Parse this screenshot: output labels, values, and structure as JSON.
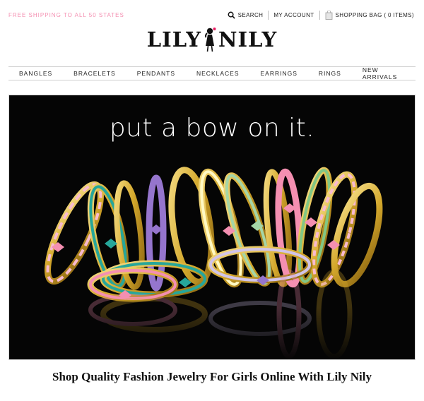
{
  "promo": {
    "text": "FREE SHIPPING TO ALL 50 STATES",
    "color": "#f48fb1"
  },
  "utility": {
    "search_label": "SEARCH",
    "account_label": "MY ACCOUNT",
    "bag_label": "SHOPPING BAG ( 0 ITEMS)"
  },
  "logo": {
    "left": "LILY",
    "right": "NILY",
    "accent_color": "#e91e63"
  },
  "nav": {
    "items": [
      "BANGLES",
      "BRACELETS",
      "PENDANTS",
      "NECKLACES",
      "EARRINGS",
      "RINGS",
      "NEW ARRIVALS"
    ]
  },
  "hero": {
    "headline": "put a bow on it."
  },
  "tagline": "Shop Quality Fashion Jewelry For Girls Online With Lily Nily"
}
